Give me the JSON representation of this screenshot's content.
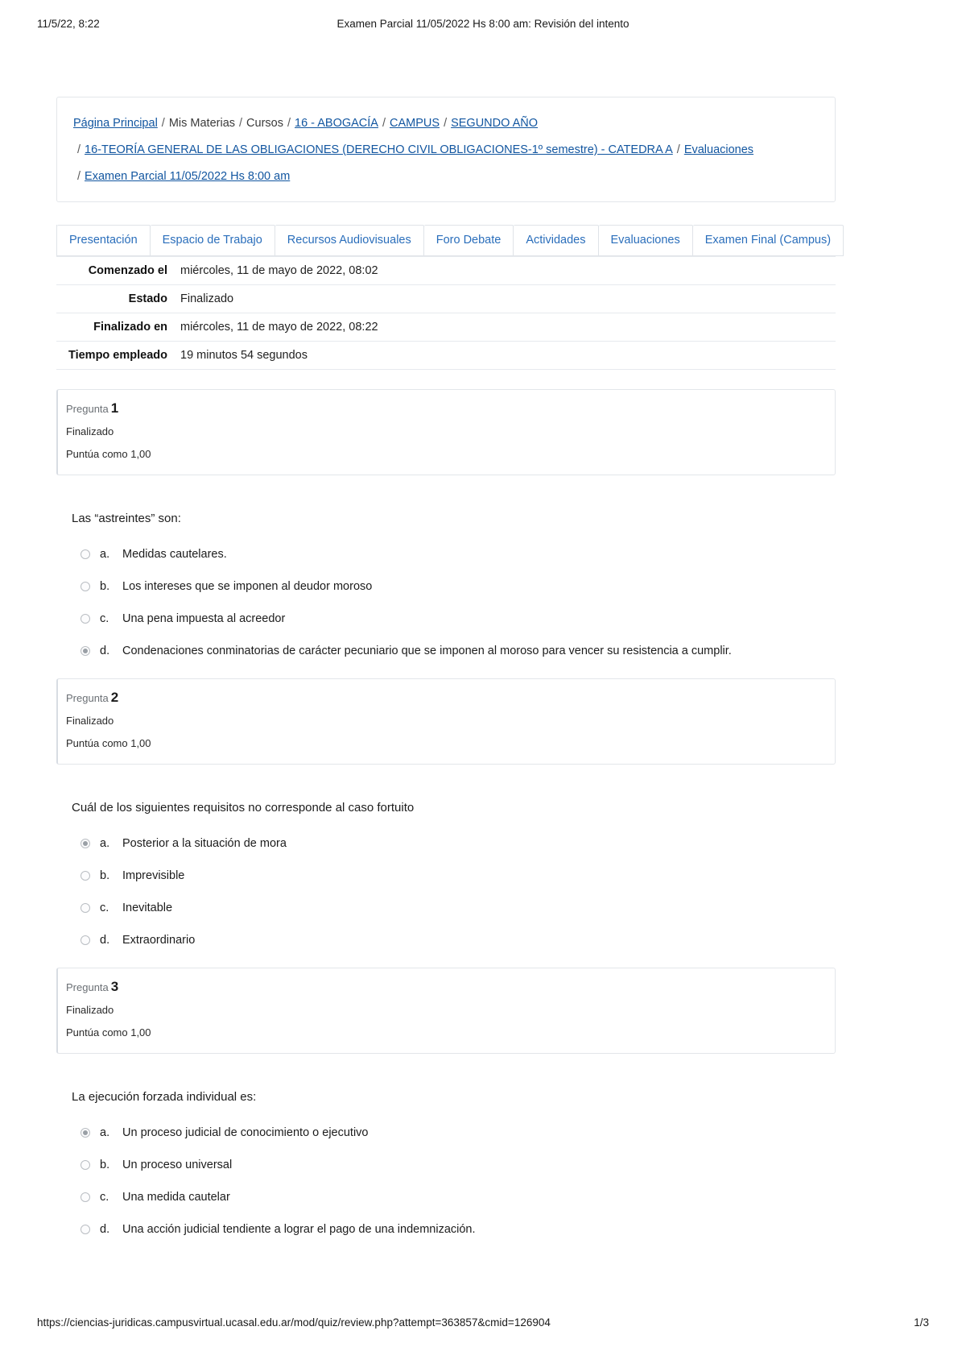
{
  "print": {
    "date": "11/5/22, 8:22",
    "doc_title": "Examen Parcial 11/05/2022 Hs 8:00 am: Revisión del intento",
    "url": "https://ciencias-juridicas.campusvirtual.ucasal.edu.ar/mod/quiz/review.php?attempt=363857&cmid=126904",
    "page_number": "1/3"
  },
  "breadcrumb": {
    "line1": [
      {
        "text": "Página Principal",
        "link": true
      },
      {
        "text": "/",
        "sep": true
      },
      {
        "text": "Mis Materias",
        "link": false
      },
      {
        "text": "/",
        "sep": true
      },
      {
        "text": "Cursos",
        "link": false
      },
      {
        "text": "/",
        "sep": true
      },
      {
        "text": "16 - ABOGACÍA",
        "link": true
      },
      {
        "text": "/",
        "sep": true
      },
      {
        "text": "CAMPUS",
        "link": true
      },
      {
        "text": "/",
        "sep": true
      },
      {
        "text": "SEGUNDO AÑO",
        "link": true
      }
    ],
    "line2": [
      {
        "text": "/",
        "sep": true
      },
      {
        "text": "16-TEORÍA GENERAL DE LAS OBLIGACIONES (DERECHO CIVIL OBLIGACIONES-1º semestre) - CATEDRA A",
        "link": true
      },
      {
        "text": "/",
        "sep": true
      },
      {
        "text": "Evaluaciones",
        "link": true
      }
    ],
    "line3": [
      {
        "text": "/",
        "sep": true
      },
      {
        "text": "Examen Parcial 11/05/2022 Hs 8:00 am",
        "link": true
      }
    ]
  },
  "tabs": [
    {
      "label": "Presentación"
    },
    {
      "label": "Espacio de Trabajo"
    },
    {
      "label": "Recursos Audiovisuales"
    },
    {
      "label": "Foro Debate"
    },
    {
      "label": "Actividades"
    },
    {
      "label": "Evaluaciones"
    },
    {
      "label": "Examen Final (Campus)"
    }
  ],
  "summary": [
    {
      "key": "Comenzado el",
      "value": "miércoles, 11 de mayo de 2022, 08:02"
    },
    {
      "key": "Estado",
      "value": "Finalizado"
    },
    {
      "key": "Finalizado en",
      "value": "miércoles, 11 de mayo de 2022, 08:22"
    },
    {
      "key": "Tiempo empleado",
      "value": "19 minutos 54 segundos"
    }
  ],
  "questions": [
    {
      "label": "Pregunta",
      "number": "1",
      "state": "Finalizado",
      "mark": "Puntúa como 1,00",
      "text": "Las “astreintes” son:",
      "options": [
        {
          "letter": "a.",
          "text": "Medidas cautelares.",
          "selected": false
        },
        {
          "letter": "b.",
          "text": "Los intereses que se imponen al deudor moroso",
          "selected": false
        },
        {
          "letter": "c.",
          "text": "Una pena impuesta al acreedor",
          "selected": false
        },
        {
          "letter": "d.",
          "text": "Condenaciones conminatorias de carácter pecuniario que se imponen al moroso para vencer su resistencia a cumplir.",
          "selected": true
        }
      ]
    },
    {
      "label": "Pregunta",
      "number": "2",
      "state": "Finalizado",
      "mark": "Puntúa como 1,00",
      "text": "Cuál de los siguientes requisitos no corresponde al caso fortuito",
      "options": [
        {
          "letter": "a.",
          "text": "Posterior a la situación de mora",
          "selected": true
        },
        {
          "letter": "b.",
          "text": "Imprevisible",
          "selected": false
        },
        {
          "letter": "c.",
          "text": "Inevitable",
          "selected": false
        },
        {
          "letter": "d.",
          "text": "Extraordinario",
          "selected": false
        }
      ]
    },
    {
      "label": "Pregunta",
      "number": "3",
      "state": "Finalizado",
      "mark": "Puntúa como 1,00",
      "text": "La ejecución forzada individual es:",
      "options": [
        {
          "letter": "a.",
          "text": "Un proceso judicial de conocimiento o ejecutivo",
          "selected": true
        },
        {
          "letter": "b.",
          "text": "Un proceso universal",
          "selected": false
        },
        {
          "letter": "c.",
          "text": "Una medida cautelar",
          "selected": false
        },
        {
          "letter": "d.",
          "text": "Una acción judicial tendiente a lograr el pago de una indemnización.",
          "selected": false
        }
      ]
    }
  ],
  "colors": {
    "link": "#1256a0",
    "tab_text": "#2a6ebb",
    "border": "#e3e6ea"
  }
}
